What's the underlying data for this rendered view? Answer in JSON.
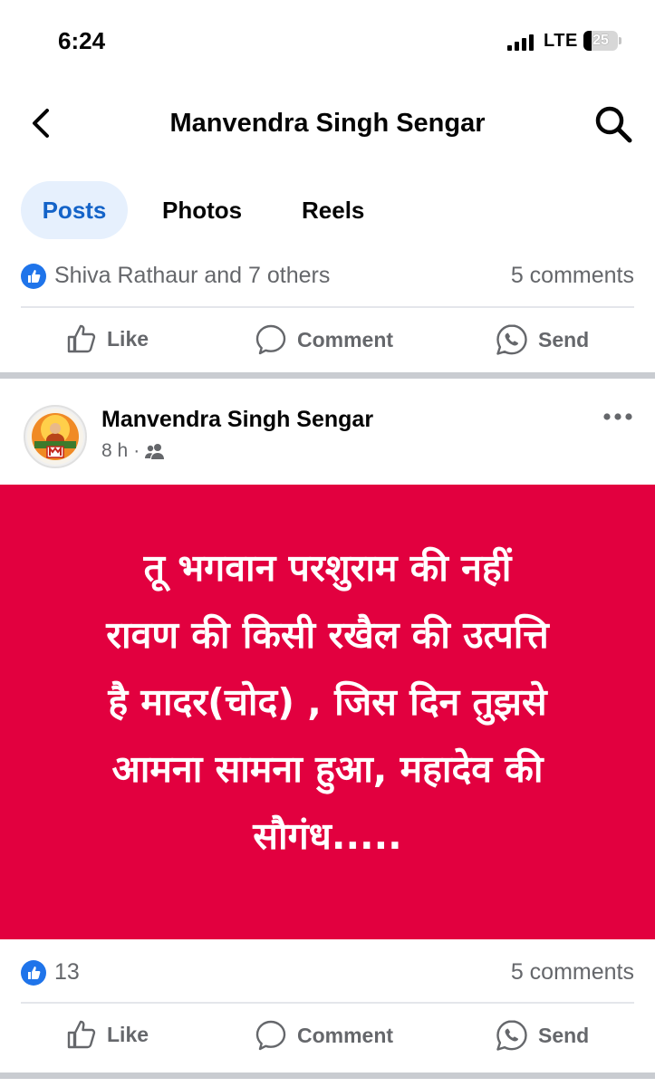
{
  "status_bar": {
    "time": "6:24",
    "network": "LTE",
    "battery": "25"
  },
  "header": {
    "title": "Manvendra Singh Sengar",
    "back_icon": "chevron-left-icon",
    "search_icon": "search-icon"
  },
  "tabs": [
    {
      "label": "Posts",
      "active": true
    },
    {
      "label": "Photos",
      "active": false
    },
    {
      "label": "Reels",
      "active": false
    }
  ],
  "prev_post": {
    "reactions": "Shiva Rathaur and 7 others",
    "comments": "5 comments",
    "actions": {
      "like": "Like",
      "comment": "Comment",
      "send": "Send"
    }
  },
  "post": {
    "author": "Manvendra Singh Sengar",
    "time": "8 h",
    "separator": "·",
    "audience_icon": "friends-icon",
    "body": "तू भगवान परशुराम की नहीं\nरावण की किसी रखैल की उत्पत्ति\nहै मादर(चोद) , जिस दिन तुझसे\nआमना सामना हुआ, महादेव की\nसौगंध.....",
    "background_color": "#e2003f",
    "reaction_count": "13",
    "comments": "5 comments",
    "actions": {
      "like": "Like",
      "comment": "Comment",
      "send": "Send"
    }
  },
  "colors": {
    "accent": "#1463c8",
    "like_blue": "#1f74ea",
    "muted": "#65676b"
  }
}
